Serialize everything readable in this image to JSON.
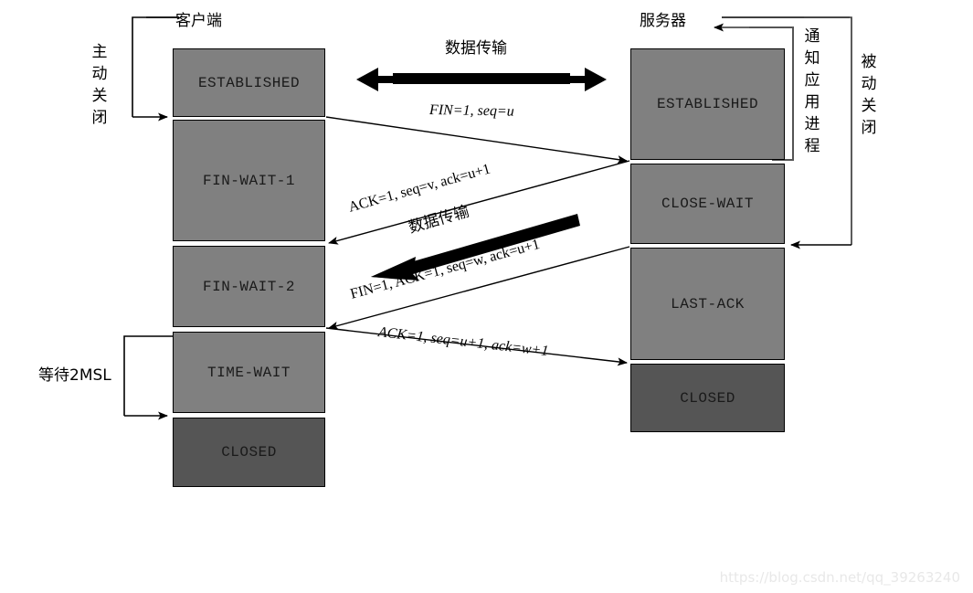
{
  "diagram": {
    "title_left": "客户端",
    "title_right": "服务器",
    "watermark": "https://blog.csdn.net/qq_39263240"
  },
  "side_labels": {
    "active_close": "主动关闭",
    "passive_close": "被动关闭",
    "notify_app": "通知应用进程",
    "wait_2msl": "等待2MSL"
  },
  "client_states": [
    {
      "label": "ESTABLISHED",
      "closed": false
    },
    {
      "label": "FIN-WAIT-1",
      "closed": false
    },
    {
      "label": "FIN-WAIT-2",
      "closed": false
    },
    {
      "label": "TIME-WAIT",
      "closed": false
    },
    {
      "label": "CLOSED",
      "closed": true
    }
  ],
  "server_states": [
    {
      "label": "ESTABLISHED",
      "closed": false
    },
    {
      "label": "CLOSE-WAIT",
      "closed": false
    },
    {
      "label": "LAST-ACK",
      "closed": false
    },
    {
      "label": "CLOSED",
      "closed": true
    }
  ],
  "messages": [
    {
      "id": "fin-1",
      "text": "FIN=1,  seq=u",
      "direction": "client-to-server"
    },
    {
      "id": "ack-1",
      "text": "ACK=1, seq=v, ack=u+1",
      "direction": "server-to-client"
    },
    {
      "id": "fin-ack-2",
      "text": "FIN=1,  ACK=1,  seq=w, ack=u+1",
      "direction": "server-to-client"
    },
    {
      "id": "ack-2",
      "text": "ACK=1, seq=u+1, ack=w+1",
      "direction": "client-to-server"
    }
  ],
  "data_transfer": [
    {
      "id": "top",
      "text": "数据传输",
      "direction": "bidirectional"
    },
    {
      "id": "middle",
      "text": "数据传输",
      "direction": "server-to-client"
    }
  ],
  "colors": {
    "state_fill": "#808080",
    "closed_fill": "#555555",
    "stroke": "#000000",
    "watermark": "#e8e8e8"
  }
}
